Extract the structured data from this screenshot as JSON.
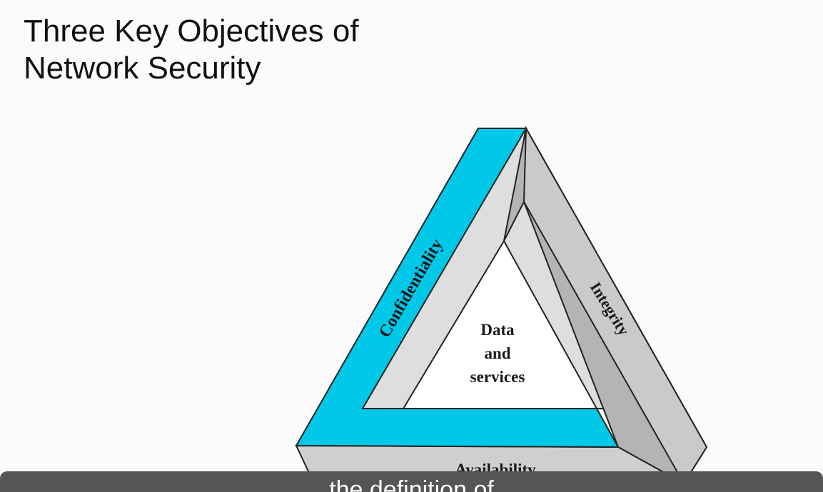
{
  "slide": {
    "title_line1": "Three Key Objectives of",
    "title_line2": "Network Security"
  },
  "diagram": {
    "confidentiality": "Confidentiality",
    "integrity": "Integrity",
    "availability": "Availability",
    "center_line1": "Data",
    "center_line2": "and",
    "center_line3": "services",
    "colors": {
      "confidentiality_band": "#00c8e8",
      "inner_face": "#dedede",
      "integrity_band": "#b4b4b4",
      "availability_band": "#cfcfcf",
      "outline": "#222222"
    }
  },
  "caption": {
    "text": "…the definition of…"
  }
}
